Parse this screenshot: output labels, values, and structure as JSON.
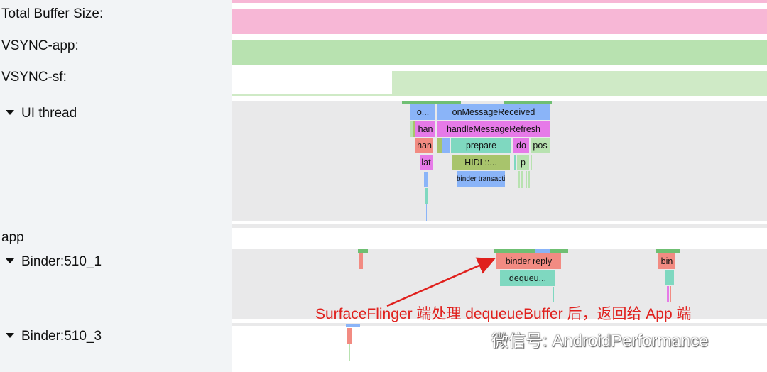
{
  "labels": {
    "total_buffer": "Total Buffer Size:",
    "vsync_app": "VSYNC-app:",
    "vsync_sf": "VSYNC-sf:",
    "ui_thread": "UI thread",
    "app": "app",
    "binder_1": "Binder:510_1",
    "binder_3": "Binder:510_3"
  },
  "slices": {
    "o": "o...",
    "on_message_received": "onMessageReceived",
    "han1": "han",
    "handle_message_refresh": "handleMessageRefresh",
    "han2": "han",
    "prepare": "prepare",
    "do": "do",
    "pos": "pos",
    "lat": "lat",
    "hidl": "HIDL::...",
    "p": "p",
    "binder_transaction": "binder transaction",
    "binder_reply": "binder reply",
    "dequeue": "dequeu...",
    "bin": "bin"
  },
  "annotation": "SurfaceFlinger 端处理 dequeueBuffer 后，返回给 App 端",
  "watermark": "微信号: AndroidPerformance",
  "colors": {
    "pink": "#f7b7d6",
    "green": "#b8e2b0",
    "light_green": "#cfeac6",
    "blue": "#8ab4f8",
    "magenta": "#e67ae8",
    "salmon": "#f28b82",
    "teal": "#7fd8c0",
    "olive": "#a8c46c",
    "red_annotation": "#e0201d"
  }
}
